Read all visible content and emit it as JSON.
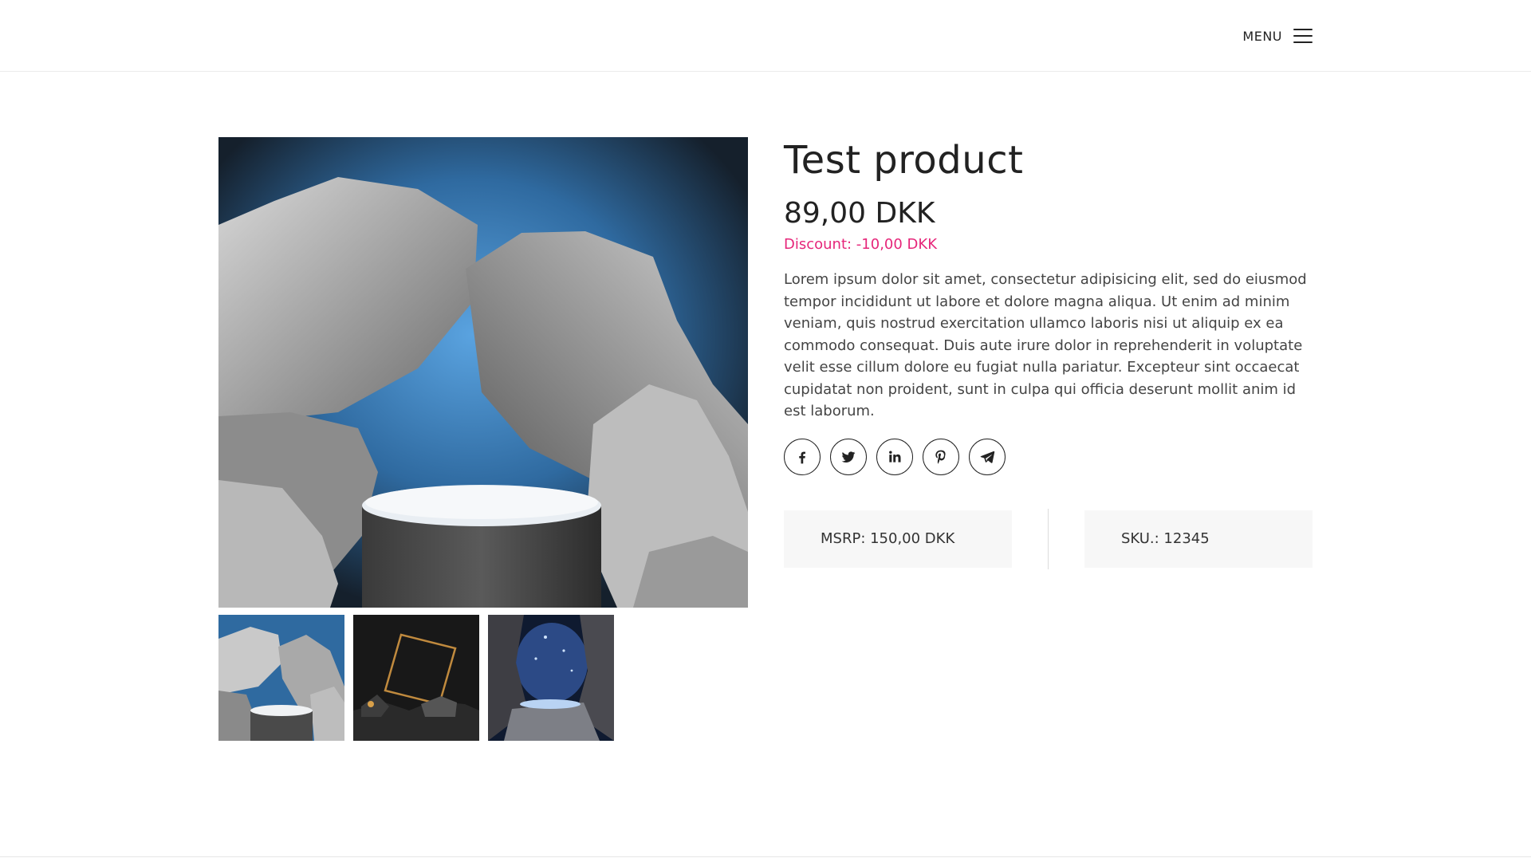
{
  "header": {
    "menu_label": "MENU",
    "menu_icon": "hamburger-icon"
  },
  "gallery": {
    "main_image": "stone-podium-image",
    "thumbnails": [
      {
        "name": "thumbnail-stones-podium"
      },
      {
        "name": "thumbnail-golden-frame"
      },
      {
        "name": "thumbnail-night-cave"
      }
    ]
  },
  "product": {
    "title": "Test product",
    "price": "89,00 DKK",
    "discount": "Discount: -10,00 DKK",
    "description": "Lorem ipsum dolor sit amet, consectetur adipisicing elit, sed do eiusmod tempor incididunt ut labore et dolore magna aliqua. Ut enim ad minim veniam, quis nostrud exercitation ullamco laboris nisi ut aliquip ex ea commodo consequat. Duis aute irure dolor in reprehenderit in voluptate velit esse cillum dolore eu fugiat nulla pariatur. Excepteur sint occaecat cupidatat non proident, sunt in culpa qui officia deserunt mollit anim id est laborum.",
    "msrp": "MSRP: 150,00 DKK",
    "sku": "SKU.: 12345"
  },
  "share": {
    "icons": [
      "facebook-icon",
      "twitter-icon",
      "linkedin-icon",
      "pinterest-icon",
      "telegram-icon"
    ]
  },
  "colors": {
    "discount": "#e6267a",
    "text": "#262626",
    "meta_bg": "#f7f7f7"
  }
}
